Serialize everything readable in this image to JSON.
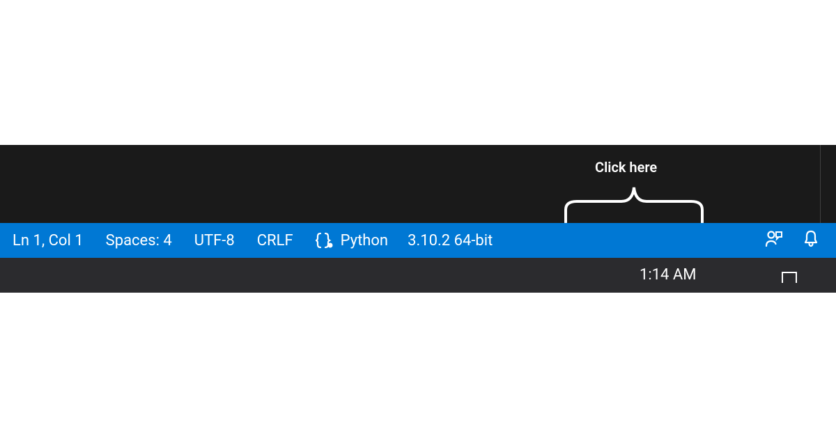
{
  "annotation": {
    "label": "Click here"
  },
  "statusbar": {
    "cursor": "Ln 1, Col 1",
    "indent": "Spaces: 4",
    "encoding": "UTF-8",
    "eol": "CRLF",
    "language": "Python",
    "interpreter": "3.10.2 64-bit"
  },
  "taskbar": {
    "clock": "1:14 AM"
  },
  "colors": {
    "statusbar_bg": "#0078d4",
    "dark_bg": "#1a1a1a",
    "taskbar_bg": "#2b2b2e"
  }
}
